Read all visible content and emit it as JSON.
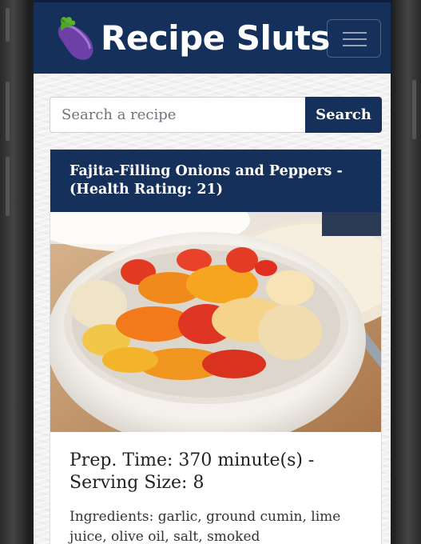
{
  "brand": {
    "title": "Recipe Sluts",
    "logo_icon": "eggplant-icon"
  },
  "navbar": {
    "toggler_icon": "hamburger-menu-icon"
  },
  "search": {
    "placeholder": "Search a recipe",
    "value": "",
    "button_label": "Search"
  },
  "recipe": {
    "title": "Fajita-Filling Onions and Peppers - (Health Rating: 21)",
    "image_icon": "recipe-photo",
    "prep_line": "Prep. Time: 370 minute(s) - Serving Size: 8",
    "ingredients": "Ingredients: garlic, ground cumin, lime juice, olive oil, salt, smoked"
  },
  "colors": {
    "primary": "#15305a",
    "background": "#f2f2f2",
    "card": "#ffffff"
  }
}
